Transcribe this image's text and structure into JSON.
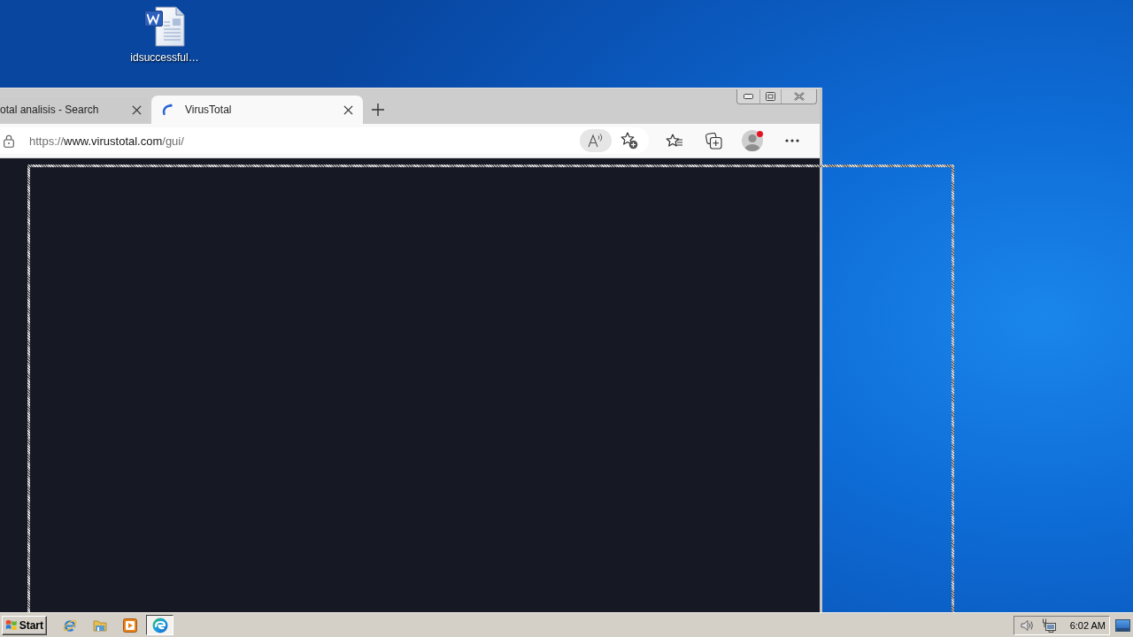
{
  "desktop": {
    "icons": [
      {
        "label": "idsuccessful…"
      }
    ]
  },
  "browser": {
    "tabs": [
      {
        "kind": "partial",
        "title": "otal analisis - Search",
        "selected": false
      },
      {
        "kind": "page",
        "title": "VirusTotal",
        "selected": true
      }
    ],
    "address": {
      "scheme": "https://",
      "host": "www.virustotal.com",
      "path": "/gui/"
    },
    "profile": {
      "notification": true
    }
  },
  "taskbar": {
    "start": "Start",
    "windows": [
      {
        "selected": true
      }
    ],
    "clock": "6:02 AM"
  }
}
